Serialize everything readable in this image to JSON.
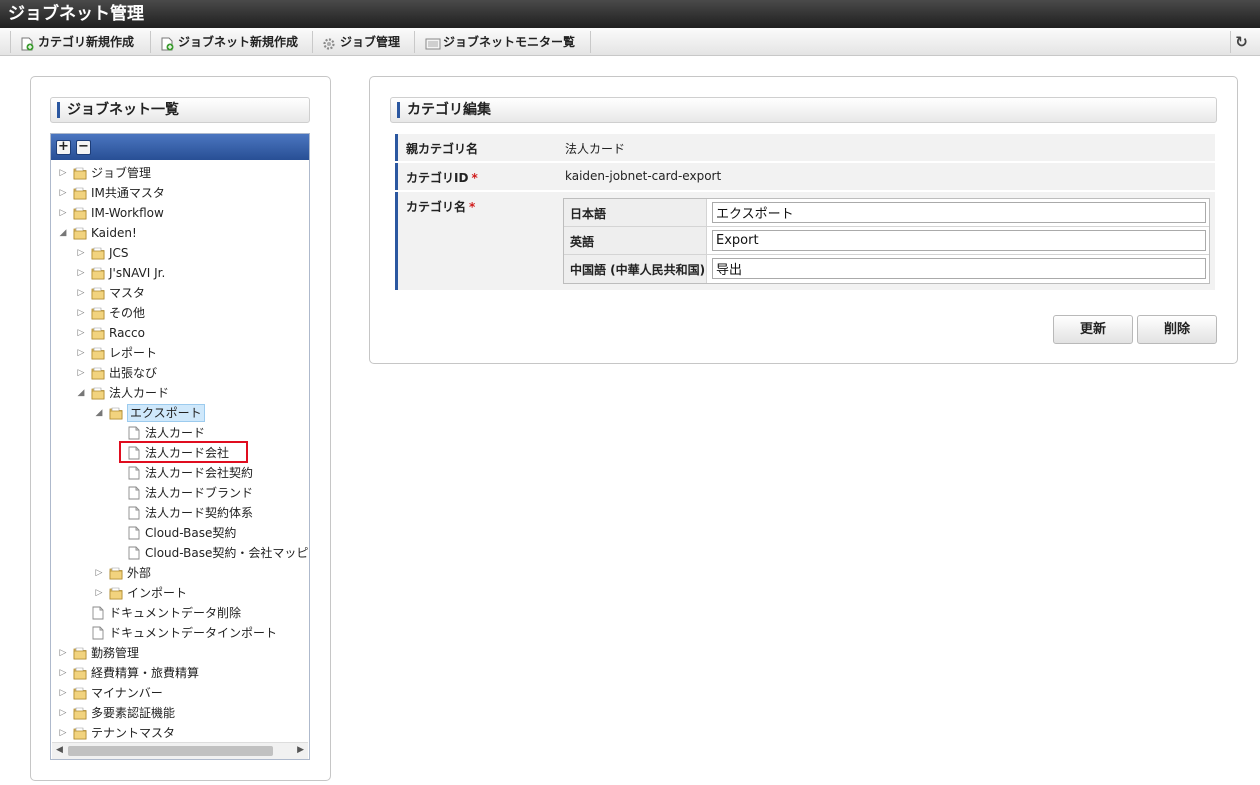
{
  "app_title": "ジョブネット管理",
  "toolbar": {
    "items": [
      {
        "label": "カテゴリ新規作成",
        "icon": "new-document-icon"
      },
      {
        "label": "ジョブネット新規作成",
        "icon": "new-document-icon"
      },
      {
        "label": "ジョブ管理",
        "icon": "gear-icon"
      },
      {
        "label": "ジョブネットモニター覧",
        "icon": "monitor-list-icon"
      }
    ],
    "refresh_icon": "refresh-icon"
  },
  "left_panel": {
    "title": "ジョブネット一覧",
    "expand_all": "+",
    "collapse_all": "−",
    "tree": [
      {
        "label": "ジョブ管理",
        "type": "folder",
        "toggle": "▷"
      },
      {
        "label": "IM共通マスタ",
        "type": "folder",
        "toggle": "▷"
      },
      {
        "label": "IM-Workflow",
        "type": "folder",
        "toggle": "▷"
      },
      {
        "label": "Kaiden!",
        "type": "folder",
        "toggle": "◢"
      },
      {
        "label": "JCS",
        "type": "folder",
        "toggle": "▷"
      },
      {
        "label": "J'sNAVI Jr.",
        "type": "folder",
        "toggle": "▷"
      },
      {
        "label": "マスタ",
        "type": "folder",
        "toggle": "▷"
      },
      {
        "label": "その他",
        "type": "folder",
        "toggle": "▷"
      },
      {
        "label": "Racco",
        "type": "folder",
        "toggle": "▷"
      },
      {
        "label": "レポート",
        "type": "folder",
        "toggle": "▷"
      },
      {
        "label": "出張なび",
        "type": "folder",
        "toggle": "▷"
      },
      {
        "label": "法人カード",
        "type": "folder",
        "toggle": "◢"
      },
      {
        "label": "エクスポート",
        "type": "folder",
        "toggle": "◢"
      },
      {
        "label": "法人カード",
        "type": "file",
        "toggle": ""
      },
      {
        "label": "法人カード会社",
        "type": "file",
        "toggle": ""
      },
      {
        "label": "法人カード会社契約",
        "type": "file",
        "toggle": ""
      },
      {
        "label": "法人カードブランド",
        "type": "file",
        "toggle": ""
      },
      {
        "label": "法人カード契約体系",
        "type": "file",
        "toggle": ""
      },
      {
        "label": "Cloud-Base契約",
        "type": "file",
        "toggle": ""
      },
      {
        "label": "Cloud-Base契約・会社マッピ",
        "type": "file",
        "toggle": ""
      },
      {
        "label": "外部",
        "type": "folder",
        "toggle": "▷"
      },
      {
        "label": "インポート",
        "type": "folder",
        "toggle": "▷"
      },
      {
        "label": "ドキュメントデータ削除",
        "type": "file",
        "toggle": ""
      },
      {
        "label": "ドキュメントデータインポート",
        "type": "file",
        "toggle": ""
      },
      {
        "label": "勤務管理",
        "type": "folder",
        "toggle": "▷"
      },
      {
        "label": "経費精算・旅費精算",
        "type": "folder",
        "toggle": "▷"
      },
      {
        "label": "マイナンバー",
        "type": "folder",
        "toggle": "▷"
      },
      {
        "label": "多要素認証機能",
        "type": "folder",
        "toggle": "▷"
      },
      {
        "label": "テナントマスタ",
        "type": "folder",
        "toggle": "▷"
      }
    ],
    "selected_index": 12,
    "highlighted_index": 14
  },
  "right_panel": {
    "title": "カテゴリ編集",
    "fields": {
      "parent_label": "親カテゴリ名",
      "parent_value": "法人カード",
      "id_label": "カテゴリID",
      "id_required": "*",
      "id_value": "kaiden-jobnet-card-export",
      "name_label": "カテゴリ名",
      "name_required": "*"
    },
    "locales": [
      {
        "label": "日本語",
        "value": "エクスポート"
      },
      {
        "label": "英語",
        "value": "Export"
      },
      {
        "label": "中国語 (中華人民共和国)",
        "value": "导出"
      }
    ],
    "buttons": {
      "update": "更新",
      "delete": "削除"
    }
  }
}
